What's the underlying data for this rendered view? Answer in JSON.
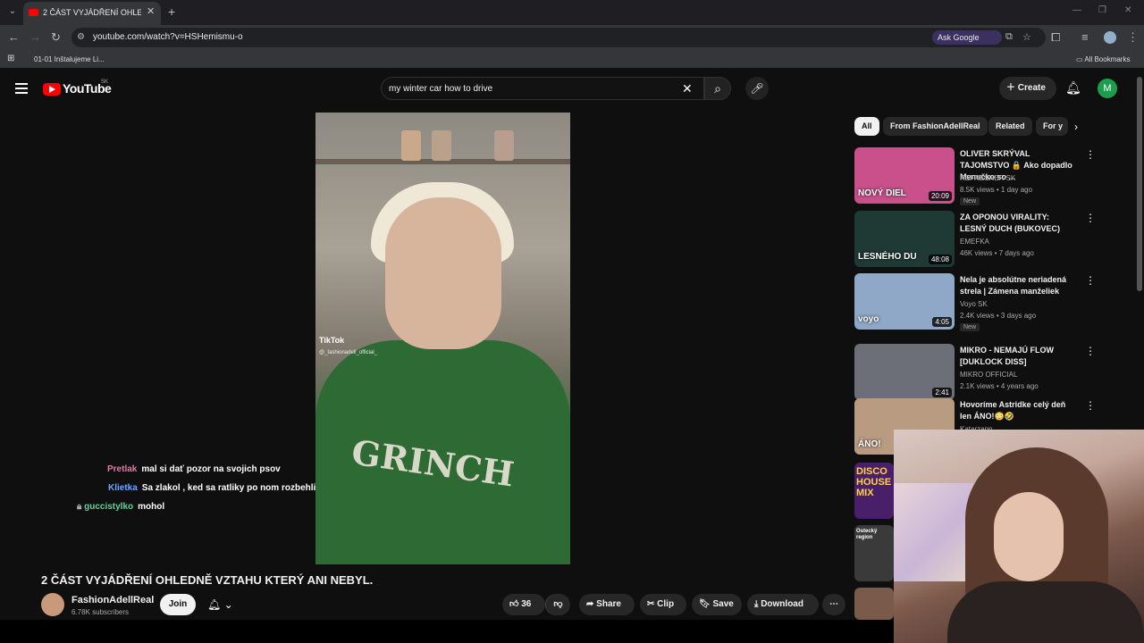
{
  "browser": {
    "tab_title": "2 ČÁST VYJÁDŘENÍ OHLEDNĚ V",
    "url": "youtube.com/watch?v=HSHemismu-o",
    "ask_google": "Ask Google",
    "bookmark_1": "01-01 Inštalujeme Li...",
    "all_bookmarks": "All Bookmarks"
  },
  "youtube": {
    "logo_text": "YouTube",
    "country": "SK",
    "search_query": "my winter car how to drive",
    "create_label": "Create",
    "avatar_letter": "M"
  },
  "video": {
    "tiktok_label": "TikTok",
    "tiktok_handle": "@_fashionadell_official_",
    "shirt_text": "GRINCH",
    "title": "2 ČÁST VYJÁDŘENÍ OHLEDNĚ VZTAHU KTERÝ ANI NEBYL.",
    "channel_name": "FashionAdellReal",
    "subscribers": "6.78K subscribers",
    "join_label": "Join",
    "likes": "36",
    "share_label": "Share",
    "clip_label": "Clip",
    "save_label": "Save",
    "download_label": "Download"
  },
  "chat": [
    {
      "name": "Pretlak",
      "message": "mal si dať pozor na svojich psov"
    },
    {
      "name": "Klietka",
      "message": "Sa zlakol , ked sa ratliky po nom rozbehli"
    },
    {
      "name": "guccistylko",
      "message": "mohol"
    }
  ],
  "chips": [
    "All",
    "From FashionAdellReal",
    "Related",
    "For y"
  ],
  "recommendations": [
    {
      "title": "OLIVER SKRÝVAL TAJOMSTVO 🔒 Ako dopadlo Menučko so ...",
      "channel": "REFRESHER SK",
      "meta": "8.5K views • 1 day ago",
      "badge": "New",
      "duration": "20:09",
      "thumb_overlay": "NOVÝ DIEL",
      "thumb_bg": "#c9508a"
    },
    {
      "title": "ZA OPONOU VIRALITY: LESNÝ DUCH (BUKOVEC)",
      "channel": "EMEFKA",
      "meta": "46K views • 7 days ago",
      "badge": "",
      "duration": "48:08",
      "thumb_overlay": "LESNÉHO DU",
      "thumb_bg": "#1f3a34"
    },
    {
      "title": "Nela je absolútne neriadená strela | Zámena manželiek",
      "channel": "Voyo SK",
      "meta": "2.4K views • 3 days ago",
      "badge": "New",
      "duration": "4:05",
      "thumb_overlay": "voyo",
      "thumb_bg": "#8fa8c8"
    },
    {
      "title": "MIKRO - NEMAJÚ FLOW [DUKLOCK DISS]",
      "channel": "MIKRO OFFICIAL",
      "meta": "2.1K views • 4 years ago",
      "badge": "",
      "duration": "2:41",
      "thumb_overlay": "",
      "thumb_bg": "#6d6f78"
    },
    {
      "title": "Hovoríme Astridke celý deň len ÁNO!😳🤣",
      "channel": "Katarzapp",
      "meta": "",
      "badge": "",
      "duration": "",
      "thumb_overlay": "ÁNO!",
      "thumb_bg": "#b99b82"
    }
  ],
  "extra_thumbs": [
    {
      "text": "DISCO HOUSE MIX",
      "bg": "#4a1f6a"
    },
    {
      "text": "Ostecký region",
      "bg": "#3a3a3a"
    },
    {
      "text": "",
      "bg": "#7a5a4a"
    }
  ]
}
